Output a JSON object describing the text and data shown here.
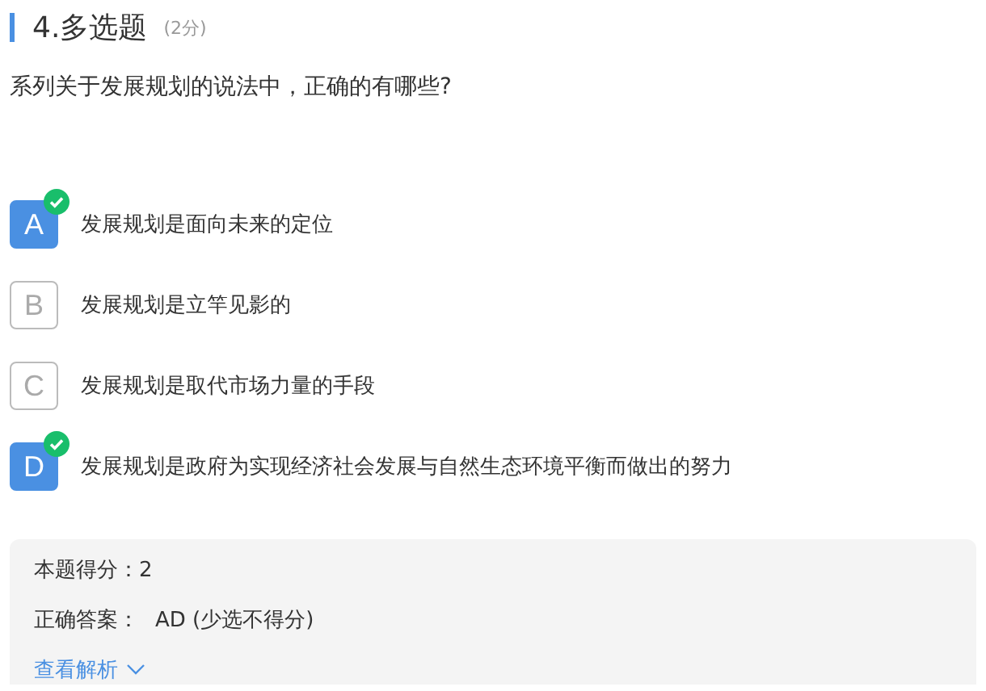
{
  "question": {
    "title": "4.多选题",
    "points": "(2分)",
    "text": "系列关于发展规划的说法中，正确的有哪些?"
  },
  "options": [
    {
      "letter": "A",
      "text": "发展规划是面向未来的定位",
      "selected": true
    },
    {
      "letter": "B",
      "text": "发展规划是立竿见影的",
      "selected": false
    },
    {
      "letter": "C",
      "text": "发展规划是取代市场力量的手段",
      "selected": false
    },
    {
      "letter": "D",
      "text": "发展规划是政府为实现经济社会发展与自然生态环境平衡而做出的努力",
      "selected": true
    }
  ],
  "result": {
    "score": "本题得分：2",
    "answer_label": "正确答案：",
    "answer_value": "AD (少选不得分)",
    "analysis_link": "查看解析"
  }
}
